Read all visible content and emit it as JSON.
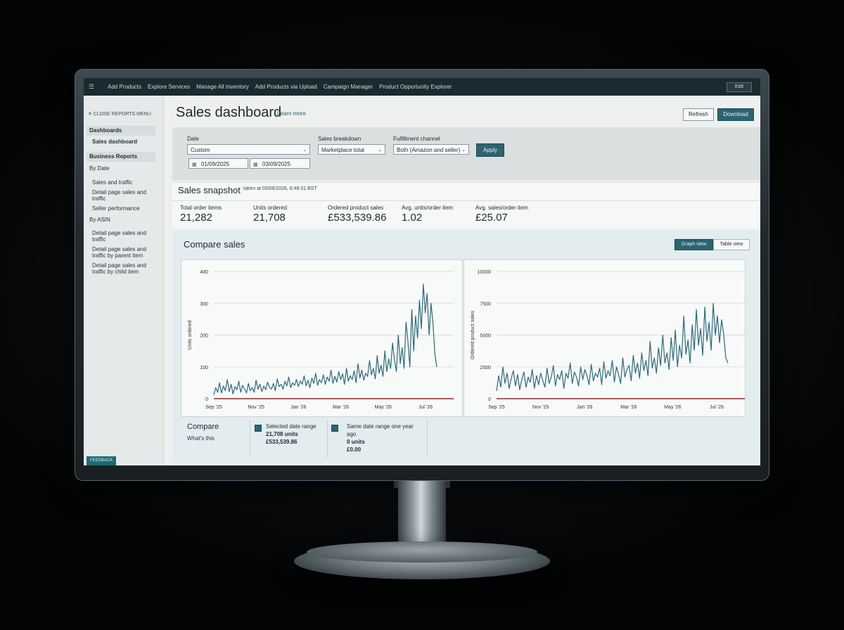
{
  "topnav": {
    "menu_icon": "☰",
    "items": [
      "Add Products",
      "Explore Services",
      "Manage All Inventory",
      "Add Products via Upload",
      "Campaign Manager",
      "Product Opportunity Explorer"
    ],
    "edit_label": "Edit"
  },
  "sidebar": {
    "close_label": "✕  CLOSE REPORTS MENU",
    "dashboards_label": "Dashboards",
    "sales_dashboard_label": "Sales dashboard",
    "business_reports_label": "Business Reports",
    "by_date_label": "By Date",
    "by_date_links": [
      "Sales and traffic",
      "Detail page sales and traffic",
      "Seller performance"
    ],
    "by_asin_label": "By ASIN",
    "by_asin_links": [
      "Detail page sales and traffic",
      "Detail page sales and traffic by parent item",
      "Detail page sales and traffic by child item"
    ],
    "feedback_label": "FEEDBACK"
  },
  "header": {
    "title": "Sales dashboard",
    "learn_more": "Learn more",
    "refresh_label": "Refresh",
    "download_label": "Download"
  },
  "filters": {
    "date_label": "Date",
    "date_value": "Custom",
    "start_date": "01/09/2025",
    "end_date": "03/09/2025",
    "breakdown_label": "Sales breakdown",
    "breakdown_value": "Marketplace total",
    "channel_label": "Fulfillment channel",
    "channel_value": "Both (Amazon and seller)",
    "apply_label": "Apply"
  },
  "snapshot": {
    "title": "Sales snapshot",
    "taken_at": "taken at 03/06/2026, 6:49:31 BST",
    "metrics": [
      {
        "label": "Total order items",
        "value": "21,282"
      },
      {
        "label": "Units ordered",
        "value": "21,708"
      },
      {
        "label": "Ordered product sales",
        "value": "£533,539.86"
      },
      {
        "label": "Avg. units/order item",
        "value": "1.02"
      },
      {
        "label": "Avg. sales/order item",
        "value": "£25.07"
      }
    ]
  },
  "compare": {
    "title": "Compare sales",
    "graph_view_label": "Graph view",
    "table_view_label": "Table view",
    "legend_title": "Compare",
    "whats_this": "What's this",
    "selected_label": "Selected date range",
    "selected_units": "21,708 units",
    "selected_sales": "£533,539.86",
    "last_year_label_1": "Same date range one year",
    "last_year_label_2": "ago",
    "last_year_units": "0 units",
    "last_year_sales": "£0.00"
  },
  "chart_data": [
    {
      "type": "line",
      "ylabel": "Units ordered",
      "ylim": [
        0,
        400
      ],
      "yticks": [
        "0",
        "100",
        "200",
        "300",
        "400"
      ],
      "xticks": [
        "Sep '25",
        "Nov '25",
        "Jan '26",
        "Mar '26",
        "May '26",
        "Jul '26"
      ],
      "series": [
        {
          "color": "#2d6a78",
          "values": [
            12,
            35,
            20,
            50,
            18,
            40,
            25,
            60,
            22,
            45,
            15,
            38,
            28,
            55,
            20,
            42,
            30,
            18,
            48,
            25,
            35,
            20,
            58,
            30,
            45,
            22,
            40,
            28,
            52,
            35,
            30,
            48,
            25,
            62,
            38,
            45,
            30,
            55,
            40,
            68,
            35,
            50,
            42,
            60,
            38,
            55,
            45,
            72,
            40,
            58,
            35,
            65,
            48,
            80,
            42,
            60,
            50,
            75,
            45,
            68,
            55,
            90,
            48,
            70,
            52,
            85,
            60,
            78,
            45,
            95,
            55,
            72,
            60,
            88,
            50,
            110,
            65,
            90,
            58,
            80,
            70,
            120,
            75,
            95,
            62,
            135,
            80,
            105,
            70,
            150,
            85,
            125,
            95,
            175,
            120,
            85,
            200,
            110,
            160,
            95,
            240,
            180,
            100,
            280,
            150,
            260,
            190,
            310,
            220,
            360,
            270,
            330,
            200,
            300,
            240,
            140,
            100
          ]
        },
        {
          "color": "#8a2a2a",
          "values": [
            0,
            0,
            0,
            0,
            0,
            0,
            0,
            0,
            0,
            0,
            0,
            0,
            0,
            0,
            0,
            0,
            0,
            0,
            0,
            0,
            0,
            0,
            0,
            0,
            0,
            0,
            0,
            0,
            0,
            0
          ]
        }
      ]
    },
    {
      "type": "line",
      "ylabel": "Ordered product sales",
      "ylim": [
        0,
        10000
      ],
      "yticks": [
        "0",
        "2500",
        "5000",
        "7500",
        "10000"
      ],
      "xticks": [
        "Sep '25",
        "Nov '25",
        "Jan '26",
        "Mar '26",
        "May '26",
        "Jul '26"
      ],
      "series": [
        {
          "color": "#2d6a78",
          "values": [
            600,
            1800,
            900,
            2500,
            1200,
            2000,
            800,
            1600,
            2200,
            1000,
            1900,
            700,
            1500,
            2100,
            900,
            1700,
            1300,
            2300,
            800,
            1800,
            1100,
            2000,
            1400,
            900,
            2400,
            1200,
            1700,
            2600,
            1000,
            1900,
            1500,
            2200,
            800,
            2000,
            1600,
            2800,
            1200,
            2100,
            1700,
            1000,
            2500,
            1500,
            2300,
            1800,
            1100,
            2700,
            1400,
            2000,
            1700,
            2400,
            1100,
            2900,
            1600,
            2200,
            1800,
            3000,
            1300,
            2500,
            1900,
            1200,
            3200,
            1700,
            2300,
            2600,
            1400,
            3400,
            2000,
            2800,
            1600,
            3600,
            2200,
            3000,
            1800,
            4500,
            2400,
            3200,
            2000,
            4000,
            2600,
            5000,
            2800,
            3600,
            2300,
            4800,
            3000,
            5400,
            2500,
            4200,
            3200,
            6500,
            3500,
            4600,
            2800,
            5800,
            3800,
            7000,
            4200,
            5500,
            3400,
            7200,
            4500,
            6000,
            3800,
            7500,
            5000,
            6500,
            4400,
            6200,
            5000,
            3200,
            2800
          ]
        },
        {
          "color": "#8a2a2a",
          "values": [
            0,
            0,
            0,
            0,
            0,
            0,
            0,
            0,
            0,
            0,
            0,
            0,
            0,
            0,
            0,
            0,
            0,
            0,
            0,
            0,
            0,
            0,
            0,
            0,
            0,
            0,
            0,
            0,
            0,
            0
          ]
        }
      ]
    }
  ]
}
